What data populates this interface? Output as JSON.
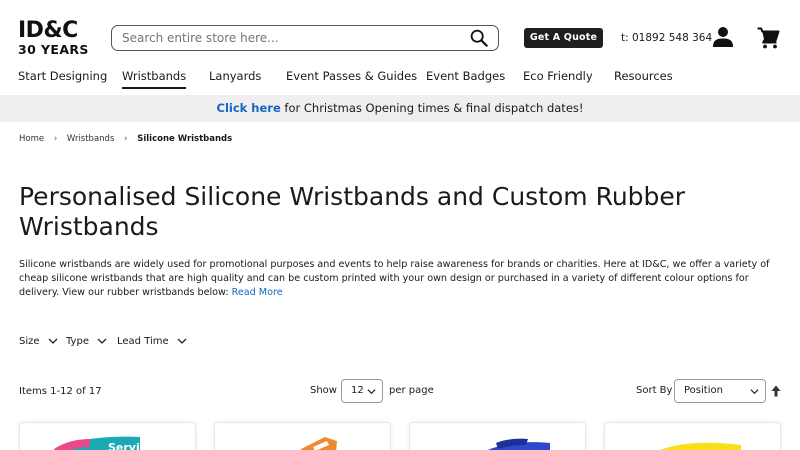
{
  "header": {
    "logo_line1": "ID&C",
    "logo_line2": "30 YEARS",
    "search_placeholder": "Search entire store here...",
    "quote_button": "Get A Quote",
    "phone": "t: 01892 548 364"
  },
  "nav": {
    "items": [
      {
        "label": "Start Designing"
      },
      {
        "label": "Wristbands",
        "active": true
      },
      {
        "label": "Lanyards"
      },
      {
        "label": "Event Passes & Guides"
      },
      {
        "label": "Event Badges"
      },
      {
        "label": "Eco Friendly"
      },
      {
        "label": "Resources"
      }
    ]
  },
  "notice": {
    "link": "Click here",
    "text": " for Christmas Opening times & final dispatch dates!"
  },
  "breadcrumb": {
    "items": [
      "Home",
      "Wristbands",
      "Silicone Wristbands"
    ]
  },
  "page": {
    "title": "Personalised Silicone Wristbands and Custom Rubber Wristbands",
    "intro": "Silicone wristbands are widely used for promotional purposes and events to help raise awareness for brands or charities. Here at ID&C, we offer a variety of cheap silicone wristbands that are high quality and can be custom printed with your own design or purchased in a variety of different colour options for delivery. View our rubber wristbands below: ",
    "read_more": "Read More"
  },
  "filters": [
    "Size",
    "Type",
    "Lead Time"
  ],
  "toolbar": {
    "count": "Items 1-12 of 17",
    "show_label": "Show",
    "limit_value": "12",
    "per_page_label": "per page",
    "sort_label": "Sort By",
    "sort_value": "Position"
  },
  "products": {
    "card1_text": "Servi"
  },
  "colors": {
    "link": "#1565c0",
    "notice_bg": "#efefef",
    "button_bg": "#1f1f1f"
  }
}
